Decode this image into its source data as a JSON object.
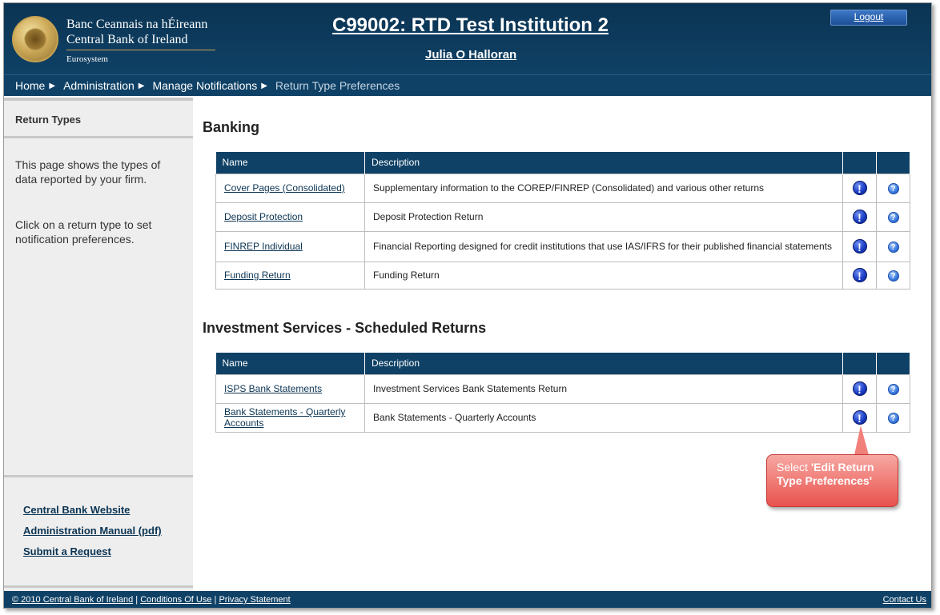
{
  "header": {
    "brand_irish": "Banc Ceannais na hÉireann",
    "brand_english": "Central Bank of Ireland",
    "brand_euro": "Eurosystem",
    "institution_title": "C99002: RTD Test Institution 2",
    "user_name": "Julia O Halloran",
    "logout_label": "Logout"
  },
  "breadcrumb": {
    "items": [
      "Home",
      "Administration",
      "Manage Notifications"
    ],
    "current": "Return Type Preferences"
  },
  "sidebar": {
    "heading": "Return Types",
    "desc_1": "This page shows the types of data reported by your firm.",
    "desc_2": "Click on a return type to set notification preferences.",
    "links": [
      "Central Bank Website",
      "Administration Manual (pdf)",
      "Submit a Request"
    ]
  },
  "sections": [
    {
      "title": "Banking",
      "columns": [
        "Name",
        "Description"
      ],
      "rows": [
        {
          "name": "Cover Pages (Consolidated)",
          "description": "Supplementary information to the COREP/FINREP (Consolidated) and various other returns"
        },
        {
          "name": "Deposit Protection",
          "description": "Deposit Protection Return"
        },
        {
          "name": "FINREP Individual",
          "description": "Financial Reporting designed for credit institutions that use IAS/IFRS for their published financial statements"
        },
        {
          "name": "Funding Return",
          "description": "Funding Return"
        }
      ]
    },
    {
      "title": "Investment Services - Scheduled Returns",
      "columns": [
        "Name",
        "Description"
      ],
      "rows": [
        {
          "name": "ISPS Bank Statements",
          "description": "Investment Services Bank Statements Return"
        },
        {
          "name": "Bank Statements - Quarterly Accounts",
          "description": "Bank Statements - Quarterly Accounts"
        }
      ]
    }
  ],
  "icons": {
    "edit": "exclamation-circle-icon",
    "help": "question-circle-icon",
    "edit_glyph": "!",
    "help_glyph": "?"
  },
  "callout": {
    "prefix": "Select ",
    "emphasis": "'Edit Return Type Preferences'"
  },
  "footer": {
    "copyright": "© 2010 Central Bank of Ireland",
    "sep": " | ",
    "conditions": "Conditions Of Use",
    "privacy": "Privacy Statement",
    "contact": "Contact Us"
  },
  "colors": {
    "navy": "#0f4166",
    "callout_red": "#e9524d",
    "edit_blue": "#1c3fc7"
  }
}
